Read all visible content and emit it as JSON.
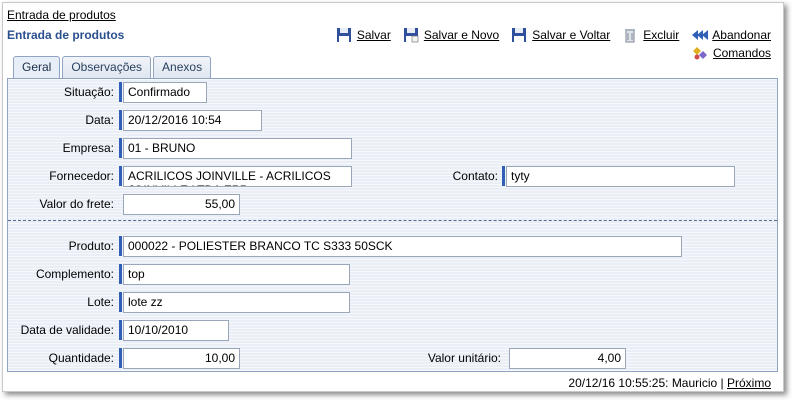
{
  "breadcrumb": "Entrada de produtos",
  "page_title": "Entrada de produtos",
  "toolbar": {
    "save": "Salvar",
    "save_new": "Salvar e Novo",
    "save_back": "Salvar e Voltar",
    "delete": "Excluir",
    "abandon": "Abandonar",
    "commands": "Comandos"
  },
  "tabs": [
    "Geral",
    "Observações",
    "Anexos"
  ],
  "form": {
    "situacao": {
      "label": "Situação:",
      "value": "Confirmado"
    },
    "data": {
      "label": "Data:",
      "value": "20/12/2016 10:54"
    },
    "empresa": {
      "label": "Empresa:",
      "value": "01 - BRUNO"
    },
    "fornecedor": {
      "label": "Fornecedor:",
      "value": "ACRILICOS JOINVILLE - ACRILICOS JOINVILLE LTDA EPP"
    },
    "contato": {
      "label": "Contato:",
      "value": "tyty"
    },
    "valor_frete": {
      "label": "Valor do frete:",
      "value": "55,00"
    },
    "produto": {
      "label": "Produto:",
      "value": "000022 - POLIESTER BRANCO TC S333 50SCK"
    },
    "complemento": {
      "label": "Complemento:",
      "value": "top"
    },
    "lote": {
      "label": "Lote:",
      "value": "lote zz"
    },
    "data_validade": {
      "label": "Data de validade:",
      "value": "10/10/2010"
    },
    "quantidade": {
      "label": "Quantidade:",
      "value": "10,00"
    },
    "valor_unitario": {
      "label": "Valor unitário:",
      "value": "4,00"
    }
  },
  "footer": {
    "stamp": "20/12/16 10:55:25: Mauricio",
    "separator": "|",
    "next": "Próximo"
  }
}
